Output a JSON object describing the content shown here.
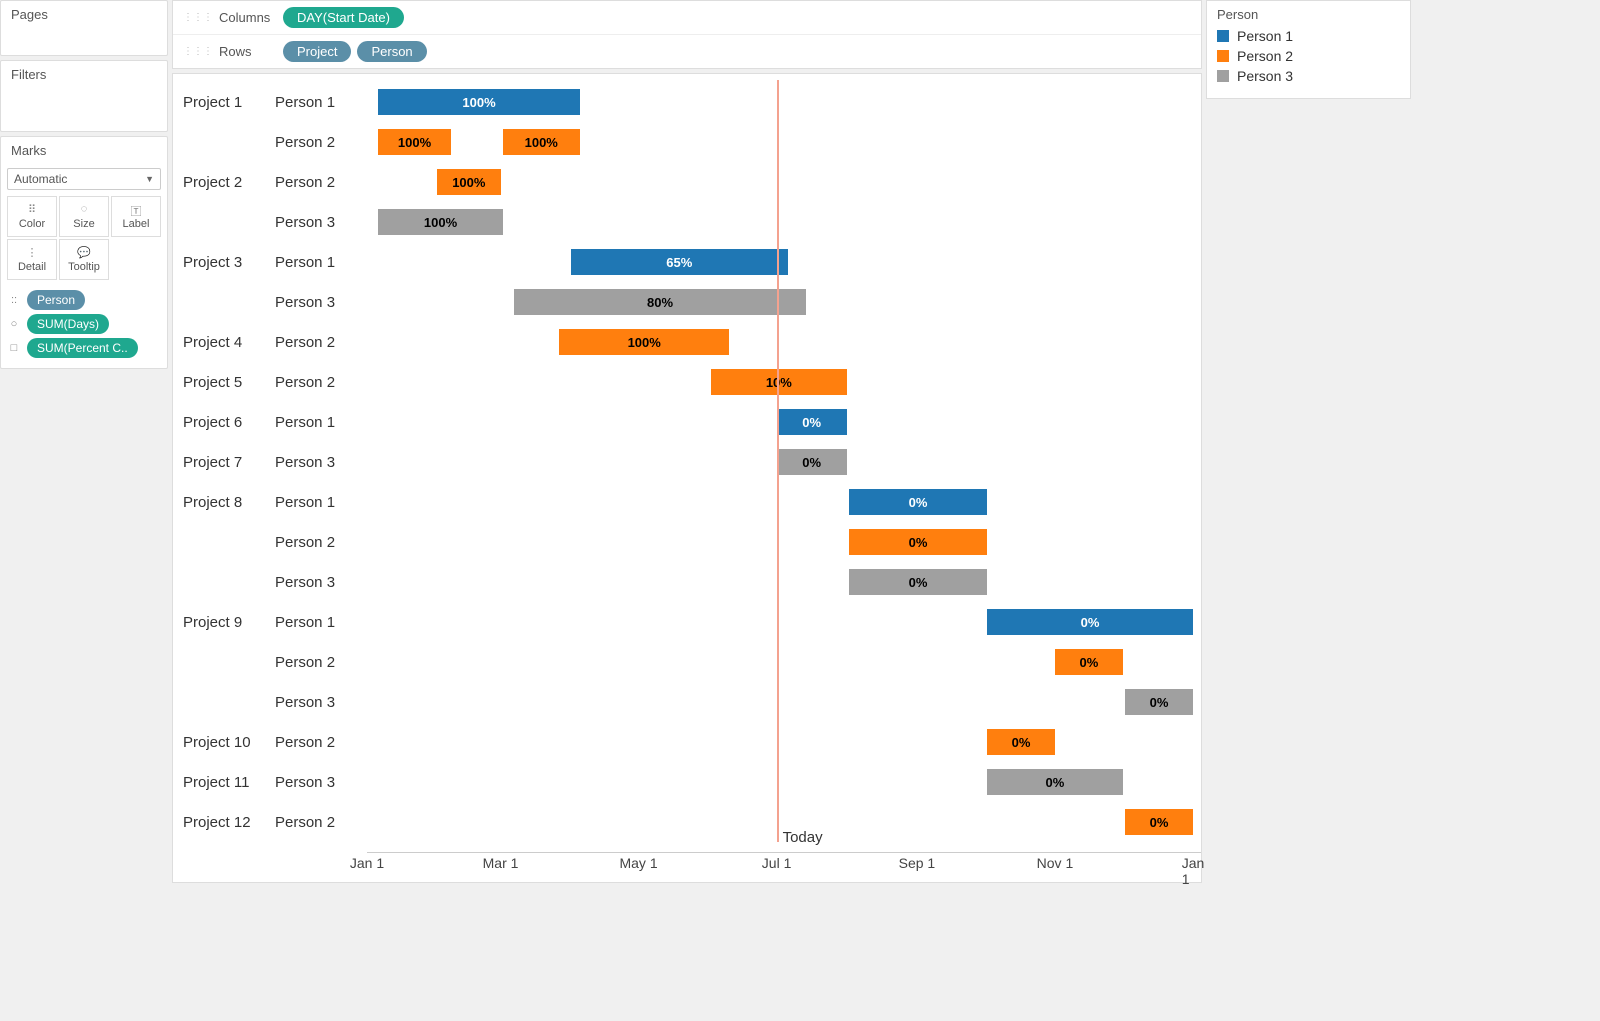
{
  "panels": {
    "pages": "Pages",
    "filters": "Filters",
    "marks": "Marks"
  },
  "marks": {
    "dropdown": "Automatic",
    "buttons": [
      "Color",
      "Size",
      "Label",
      "Detail",
      "Tooltip"
    ],
    "pills": [
      {
        "icon": "::",
        "label": "Person",
        "color": "blue"
      },
      {
        "icon": "○",
        "label": "SUM(Days)",
        "color": "teal"
      },
      {
        "icon": "□",
        "label": "SUM(Percent C..",
        "color": "teal"
      }
    ]
  },
  "shelves": {
    "columns_label": "Columns",
    "rows_label": "Rows",
    "columns": [
      {
        "label": "DAY(Start Date)",
        "color": "green"
      }
    ],
    "rows": [
      {
        "label": "Project",
        "color": "blue"
      },
      {
        "label": "Person",
        "color": "blue"
      }
    ]
  },
  "legend": {
    "title": "Person",
    "items": [
      {
        "label": "Person 1",
        "color": "blue"
      },
      {
        "label": "Person 2",
        "color": "orange"
      },
      {
        "label": "Person 3",
        "color": "gray"
      }
    ]
  },
  "axis": {
    "domain": [
      0,
      365
    ],
    "today": 181,
    "today_label": "Today",
    "ticks": [
      {
        "label": "Jan 1",
        "pos": 0
      },
      {
        "label": "Mar 1",
        "pos": 59
      },
      {
        "label": "May 1",
        "pos": 120
      },
      {
        "label": "Jul 1",
        "pos": 181
      },
      {
        "label": "Sep 1",
        "pos": 243
      },
      {
        "label": "Nov 1",
        "pos": 304
      },
      {
        "label": "Jan 1",
        "pos": 365
      }
    ]
  },
  "chart_data": {
    "type": "gantt-bar",
    "x_unit": "day-of-year",
    "color_field": "person",
    "label_field": "percent_complete",
    "rows": [
      {
        "project": "Project 1",
        "person": "Person 1",
        "start": 5,
        "days": 89,
        "pct": "100%",
        "color": "blue"
      },
      {
        "project": "Project 1",
        "person": "Person 2",
        "start": 5,
        "days": 32,
        "pct": "100%",
        "color": "orange"
      },
      {
        "project": "Project 1",
        "person": "Person 2",
        "start": 60,
        "days": 34,
        "pct": "100%",
        "color": "orange",
        "same_row": true
      },
      {
        "project": "Project 2",
        "person": "Person 2",
        "start": 31,
        "days": 28,
        "pct": "100%",
        "color": "orange"
      },
      {
        "project": "Project 2",
        "person": "Person 3",
        "start": 5,
        "days": 55,
        "pct": "100%",
        "color": "gray"
      },
      {
        "project": "Project 3",
        "person": "Person 1",
        "start": 90,
        "days": 96,
        "pct": "65%",
        "color": "blue"
      },
      {
        "project": "Project 3",
        "person": "Person 3",
        "start": 65,
        "days": 129,
        "pct": "80%",
        "color": "gray"
      },
      {
        "project": "Project 4",
        "person": "Person 2",
        "start": 85,
        "days": 75,
        "pct": "100%",
        "color": "orange"
      },
      {
        "project": "Project 5",
        "person": "Person 2",
        "start": 152,
        "days": 60,
        "pct": "10%",
        "color": "orange"
      },
      {
        "project": "Project 6",
        "person": "Person 1",
        "start": 181,
        "days": 31,
        "pct": "0%",
        "color": "blue"
      },
      {
        "project": "Project 7",
        "person": "Person 3",
        "start": 181,
        "days": 31,
        "pct": "0%",
        "color": "gray"
      },
      {
        "project": "Project 8",
        "person": "Person 1",
        "start": 213,
        "days": 61,
        "pct": "0%",
        "color": "blue"
      },
      {
        "project": "Project 8",
        "person": "Person 2",
        "start": 213,
        "days": 61,
        "pct": "0%",
        "color": "orange"
      },
      {
        "project": "Project 8",
        "person": "Person 3",
        "start": 213,
        "days": 61,
        "pct": "0%",
        "color": "gray"
      },
      {
        "project": "Project 9",
        "person": "Person 1",
        "start": 274,
        "days": 91,
        "pct": "0%",
        "color": "blue"
      },
      {
        "project": "Project 9",
        "person": "Person 2",
        "start": 304,
        "days": 30,
        "pct": "0%",
        "color": "orange"
      },
      {
        "project": "Project 9",
        "person": "Person 3",
        "start": 335,
        "days": 30,
        "pct": "0%",
        "color": "gray"
      },
      {
        "project": "Project 10",
        "person": "Person 2",
        "start": 274,
        "days": 30,
        "pct": "0%",
        "color": "orange"
      },
      {
        "project": "Project 11",
        "person": "Person 3",
        "start": 274,
        "days": 60,
        "pct": "0%",
        "color": "gray"
      },
      {
        "project": "Project 12",
        "person": "Person 2",
        "start": 335,
        "days": 30,
        "pct": "0%",
        "color": "orange"
      }
    ]
  }
}
